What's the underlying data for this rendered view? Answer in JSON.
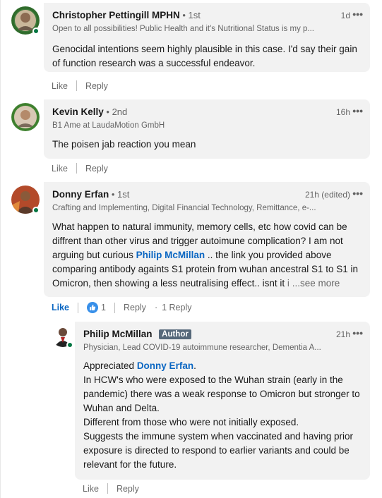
{
  "colors": {
    "link": "#0a66c2",
    "bubble": "#f2f2f2",
    "presence": "#057642",
    "badge": "#56687a"
  },
  "comments": [
    {
      "name": "Christopher Pettingill MPHN",
      "degree": "• 1st",
      "headline": "Open to all possibilities! Public Health and it's Nutritional Status is my p...",
      "time": "1d",
      "text": "Genocidal intentions seem highly plausible in this case. I'd say their gain of function research was a successful endeavor.",
      "like": "Like",
      "reply": "Reply"
    },
    {
      "name": "Kevin Kelly",
      "degree": "• 2nd",
      "headline": "B1 Ame at LaudaMotion GmbH",
      "time": "16h",
      "text": "The poisen jab reaction you mean",
      "like": "Like",
      "reply": "Reply"
    },
    {
      "name": "Donny Erfan",
      "degree": "• 1st",
      "headline": "Crafting and Implementing, Digital Financial Technology, Remittance, e-...",
      "time": "21h (edited)",
      "text_a": "What happen to natural immunity, memory cells, etc how covid can be diffrent than other virus and trigger autoimune complication? I am not arguing but curious ",
      "mention": "Philip McMillan",
      "text_b": " .. the link you provided above comparing antibody againts S1 protein from wuhan ancestral S1 to S1 in Omicron, then showing a less neutralising effect.. isnt it ",
      "text_fade": "i",
      "see_more": "...see more",
      "like": "Like",
      "reaction_count": "1",
      "reply": "Reply",
      "replies": "1 Reply"
    }
  ],
  "reply": {
    "name": "Philip McMillan",
    "badge": "Author",
    "headline": "Physician, Lead COVID-19 autoimmune researcher, Dementia A...",
    "time": "21h",
    "greeting": "Appreciated ",
    "mention": "Donny Erfan",
    "greeting_end": ".",
    "lines": [
      "In HCW's who were exposed to the Wuhan strain (early in the pandemic) there was a weak response to Omicron but stronger to Wuhan and Delta.",
      "Different from those who were not initially exposed.",
      "Suggests the immune system when vaccinated and having prior exposure is directed to respond to earlier variants and could be relevant for the future."
    ],
    "like": "Like",
    "reply": "Reply"
  }
}
